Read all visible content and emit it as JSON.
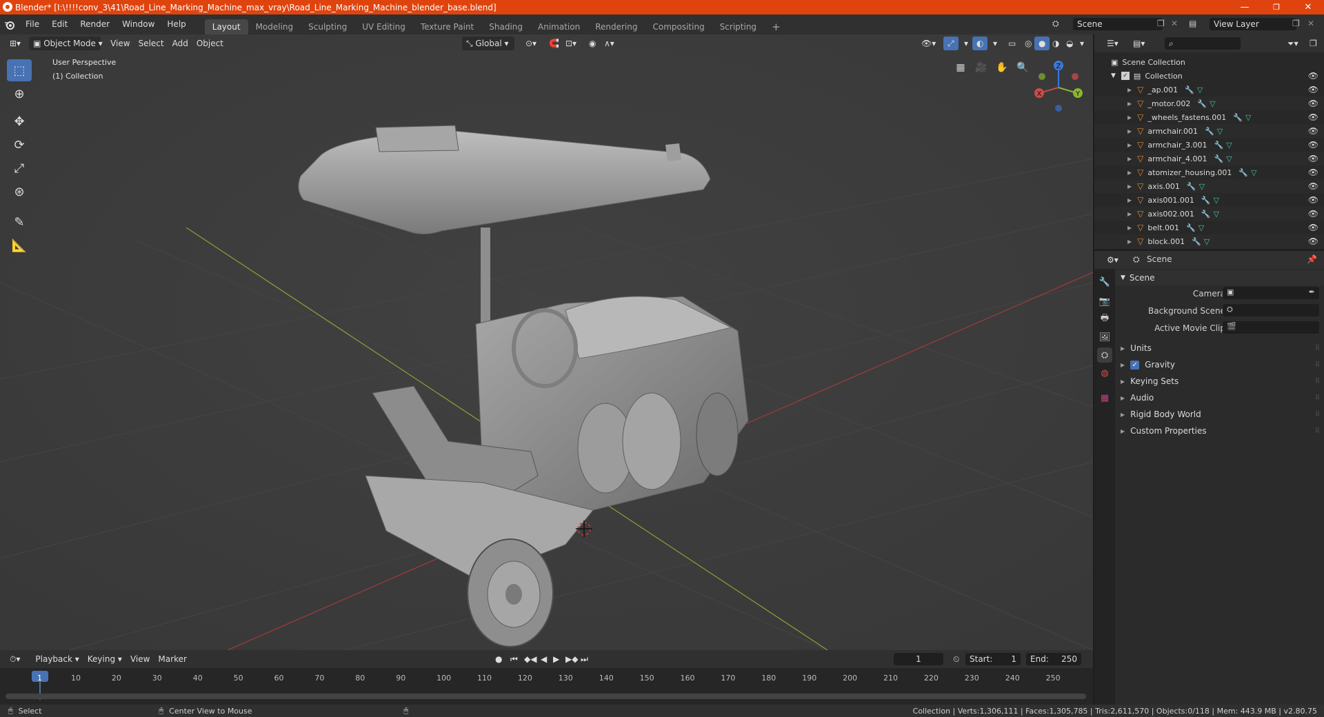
{
  "window": {
    "title": "Blender* [I:\\!!!!conv_3\\41\\Road_Line_Marking_Machine_max_vray\\Road_Line_Marking_Machine_blender_base.blend]",
    "controls": [
      "—",
      "❐",
      "✕"
    ]
  },
  "menubar": {
    "menus": [
      "File",
      "Edit",
      "Render",
      "Window",
      "Help"
    ],
    "workspaces": [
      "Layout",
      "Modeling",
      "Sculpting",
      "UV Editing",
      "Texture Paint",
      "Shading",
      "Animation",
      "Rendering",
      "Compositing",
      "Scripting"
    ],
    "active_workspace": "Layout",
    "add_tab": "+",
    "scene_name": "Scene",
    "view_layer_name": "View Layer"
  },
  "viewport": {
    "mode": "Object Mode",
    "menus": [
      "View",
      "Select",
      "Add",
      "Object"
    ],
    "transform_orientation": "Global",
    "overlay_line1": "User Perspective",
    "overlay_line2": "(1) Collection",
    "gizmo_axes": [
      "Z",
      "Y",
      "X"
    ],
    "tools": [
      "select-box",
      "cursor",
      "move",
      "rotate",
      "scale",
      "transform",
      "annotate",
      "measure"
    ],
    "colors": {
      "x_axis": "#9a3b3b",
      "y_axis": "#8a9a35",
      "accent": "#4772b3"
    }
  },
  "timeline": {
    "menus": [
      "Playback",
      "Keying",
      "View",
      "Marker"
    ],
    "current_frame": "1",
    "start_label": "Start:",
    "start_value": "1",
    "end_label": "End:",
    "end_value": "250",
    "ticks": [
      "1",
      "10",
      "20",
      "30",
      "40",
      "50",
      "60",
      "70",
      "80",
      "90",
      "100",
      "110",
      "120",
      "130",
      "140",
      "150",
      "160",
      "170",
      "180",
      "190",
      "200",
      "210",
      "220",
      "230",
      "240",
      "250"
    ]
  },
  "statusbar": {
    "left_action": "Select",
    "mid_action": "Center View to Mouse",
    "stats": "Collection | Verts:1,306,111 | Faces:1,305,785 | Tris:2,611,570 | Objects:0/118 | Mem: 443.9 MB | v2.80.75"
  },
  "outliner": {
    "root": "Scene Collection",
    "collection": "Collection",
    "items": [
      "_ap.001",
      "_motor.002",
      "_wheels_fastens.001",
      "armchair.001",
      "armchair_3.001",
      "armchair_4.001",
      "atomizer_housing.001",
      "axis.001",
      "axis001.001",
      "axis002.001",
      "belt.001",
      "block.001"
    ]
  },
  "properties": {
    "context": "Scene",
    "panel_title": "Scene",
    "fields": [
      {
        "label": "Camera"
      },
      {
        "label": "Background Scene"
      },
      {
        "label": "Active Movie Clip"
      }
    ],
    "sections": [
      "Units",
      "Gravity",
      "Keying Sets",
      "Audio",
      "Rigid Body World",
      "Custom Properties"
    ],
    "gravity_checked": true
  }
}
